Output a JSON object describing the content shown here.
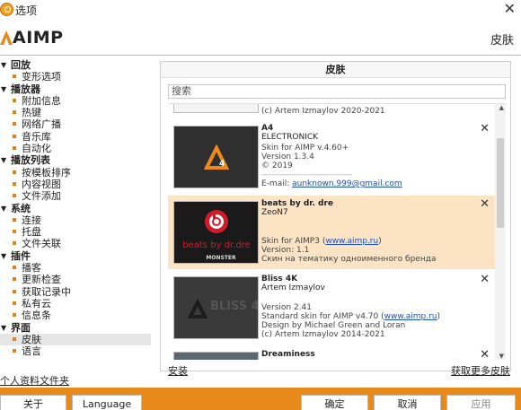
{
  "window": {
    "title": "选项",
    "close_glyph": "✕"
  },
  "header": {
    "logo_text": "AIMP",
    "section_title": "皮肤"
  },
  "nav": {
    "groups": [
      {
        "label": "回放",
        "items": [
          "变形选项"
        ]
      },
      {
        "label": "播放器",
        "items": [
          "附加信息",
          "热键",
          "网络广播",
          "音乐库",
          "自动化"
        ]
      },
      {
        "label": "播放列表",
        "items": [
          "按模板排序",
          "内容视图",
          "文件添加"
        ]
      },
      {
        "label": "系统",
        "items": [
          "连接",
          "托盘",
          "文件关联"
        ]
      },
      {
        "label": "插件",
        "items": [
          "播客",
          "更新检查",
          "获取记录中",
          "私有云",
          "信息条"
        ]
      },
      {
        "label": "界面",
        "items": [
          "皮肤",
          "语言"
        ]
      }
    ],
    "selected_item": "皮肤",
    "profile_link": "个人资料文件夹"
  },
  "panel": {
    "title": "皮肤",
    "search_placeholder": "搜索",
    "top_partial_line": "(c) Artem Izmaylov 2020-2021",
    "skins": [
      {
        "name": "A4",
        "author": "ELECTRONICK",
        "lines": [
          "Skin for AIMP v.4.60+",
          "Version 1.3.4",
          "© 2019",
          "-----------------------------------",
          "E-mail: "
        ],
        "link": "aunknown.999@gmail.com",
        "selected": false
      },
      {
        "name": "beats by dr. dre",
        "author": "ZeoN7",
        "lines": [
          "Skin for AIMP3 (",
          "Version: 1.1",
          "Скин на тематику одноименного бренда"
        ],
        "link": "www.aimp.ru",
        "thumb_text": "beats by dr.dre",
        "thumb_brand": "MONSTER",
        "selected": true
      },
      {
        "name": "Bliss 4K",
        "author": "Artem Izmaylov",
        "lines": [
          "Version 2.41",
          "Standard skin for AIMP v4.70 (",
          "Design by Michael Green and Loran",
          "(c) Artem Izmaylov 2014-2021"
        ],
        "link": "www.aimp.ru",
        "thumb_text": "BLISS 4K",
        "selected": false
      },
      {
        "name": "Dreaminess",
        "selected": false
      }
    ],
    "install_label": "安装",
    "get_more_label": "获取更多皮肤"
  },
  "footer": {
    "about": "关于",
    "language": "Language",
    "ok": "确定",
    "cancel": "取消",
    "apply": "应用"
  },
  "colors": {
    "accent": "#e88a1a",
    "selected_row": "#fbe3c4",
    "link": "#1f4fb8"
  }
}
